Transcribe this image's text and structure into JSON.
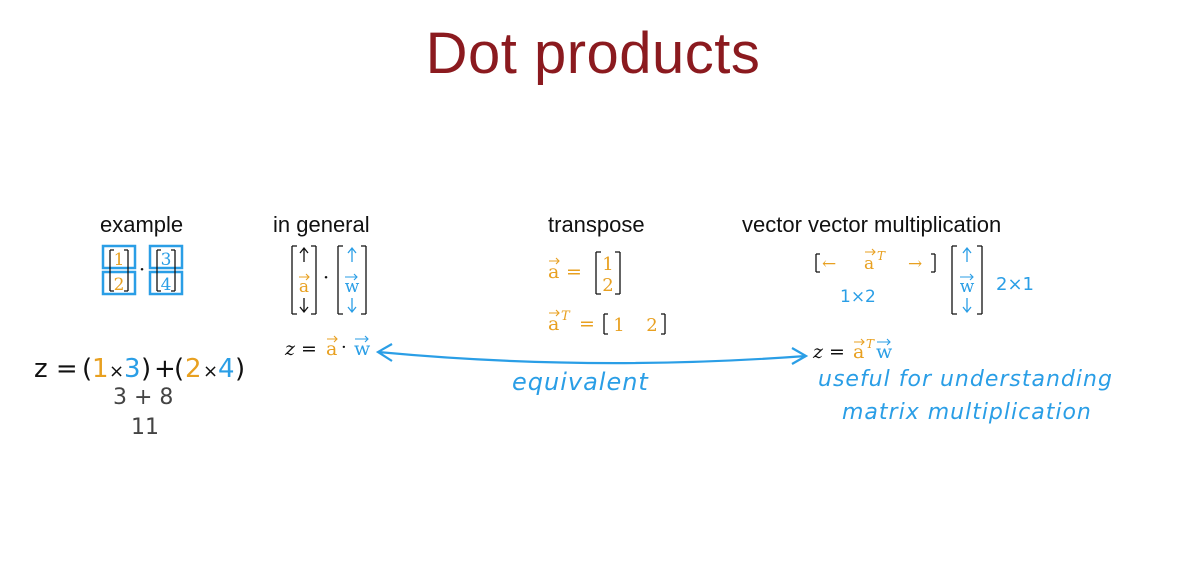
{
  "title": "Dot products",
  "headings": {
    "example": "example",
    "general": "in general",
    "transpose": "transpose",
    "vvm": "vector vector multiplication"
  },
  "example": {
    "vec1": [
      "1",
      "2"
    ],
    "vec2": [
      "3",
      "4"
    ],
    "dot": "·",
    "eq_z": "z =",
    "eq_open1": "(",
    "eq_a1": "1",
    "eq_times1": "×",
    "eq_b1": "3",
    "eq_close1": ")",
    "eq_plus": "+",
    "eq_open2": "(",
    "eq_a2": "2",
    "eq_times2": "×",
    "eq_b2": "4",
    "eq_close2": ")",
    "step1": "3  +  8",
    "result": "11"
  },
  "general": {
    "a_label": "a",
    "w_label": "w",
    "dot": "·",
    "eq_z": "z =",
    "eq_a": "a",
    "eq_dot": "·",
    "eq_w": "w"
  },
  "transpose": {
    "a_label": "a",
    "a_eq": "=",
    "a_vals": [
      "1",
      "2"
    ],
    "aT_label": "a",
    "aT_sup": "T",
    "aT_eq": "=",
    "aT_vals": [
      "1",
      "2"
    ]
  },
  "vvm": {
    "left_arrow": "←",
    "row_label": "a",
    "row_sup": "T",
    "right_arrow": "→",
    "row_dim": "1×2",
    "col_label": "w",
    "col_dim": "2×1",
    "eq_z": "z =",
    "eq_a": "a",
    "eq_sup": "T",
    "eq_w": "w"
  },
  "annotations": {
    "equivalent": "equivalent",
    "useful_line1": "useful for understanding",
    "useful_line2": "matrix multiplication"
  },
  "colors": {
    "title": "#8b1a1f",
    "blue": "#2a9ee6",
    "orange": "#e8a020"
  }
}
